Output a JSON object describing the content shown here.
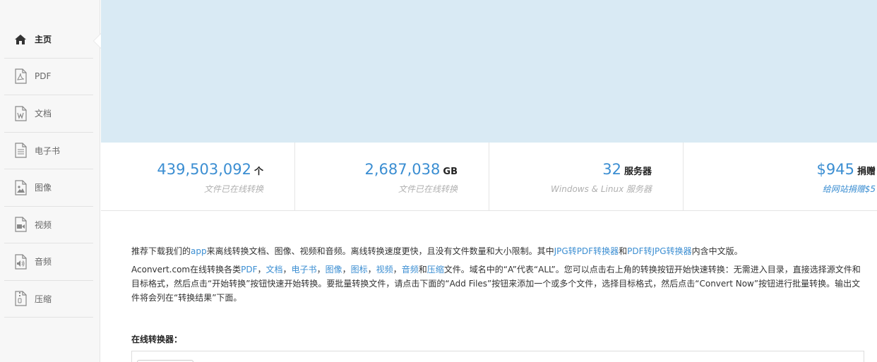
{
  "sidebar": {
    "items": [
      {
        "label": "主页",
        "icon": "home-icon"
      },
      {
        "label": "PDF",
        "icon": "pdf-file-icon"
      },
      {
        "label": "文档",
        "icon": "word-doc-icon"
      },
      {
        "label": "电子书",
        "icon": "ebook-icon"
      },
      {
        "label": "图像",
        "icon": "image-file-icon"
      },
      {
        "label": "视频",
        "icon": "video-file-icon"
      },
      {
        "label": "音频",
        "icon": "audio-file-icon"
      },
      {
        "label": "压缩",
        "icon": "archive-file-icon"
      }
    ]
  },
  "stats": [
    {
      "num": "439,503,092",
      "unit": "个",
      "sub": "文件已在线转换"
    },
    {
      "num": "2,687,038",
      "unit": "GB",
      "sub": "文件已在线转换"
    },
    {
      "num": "32",
      "unit": "服务器",
      "sub": "Windows & Linux 服务器"
    },
    {
      "num": "$945",
      "unit": "捐赠",
      "sub": "给网站捐赠$5"
    }
  ],
  "content": {
    "p1": {
      "t1": "推荐下载我们的",
      "link_app": "app",
      "t2": "来离线转换文档、图像、视频和音频。离线转换速度更快，且没有文件数量和大小限制。其中",
      "link_jpg2pdf": "JPG转PDF转换器",
      "t3": "和",
      "link_pdf2jpg": "PDF转JPG转换器",
      "t4": "内含中文版。"
    },
    "p2": {
      "t1": "Aconvert.com在线转换各类",
      "link_pdf": "PDF",
      "sep1": "，",
      "link_doc": "文档",
      "sep2": "，",
      "link_ebook": "电子书",
      "sep3": "，",
      "link_image": "图像",
      "sep4": "，",
      "link_icon": "图标",
      "sep5": "，",
      "link_video": "视频",
      "sep6": "，",
      "link_audio": "音频",
      "t2": "和",
      "link_archive": "压缩",
      "t3": "文件。域名中的“A”代表“ALL”。您可以点击右上角的转换按钮开始快速转换：无需进入目录，直接选择源文件和目标格式，然后点击“开始转换”按钮快速开始转换。要批量转换文件，请点击下面的“Add Files”按钮来添加一个或多个文件，选择目标格式，然后点击“Convert Now”按钮进行批量转换。输出文件将会列在“转换结果”下面。"
    }
  },
  "converters": {
    "title": "在线转换器："
  }
}
